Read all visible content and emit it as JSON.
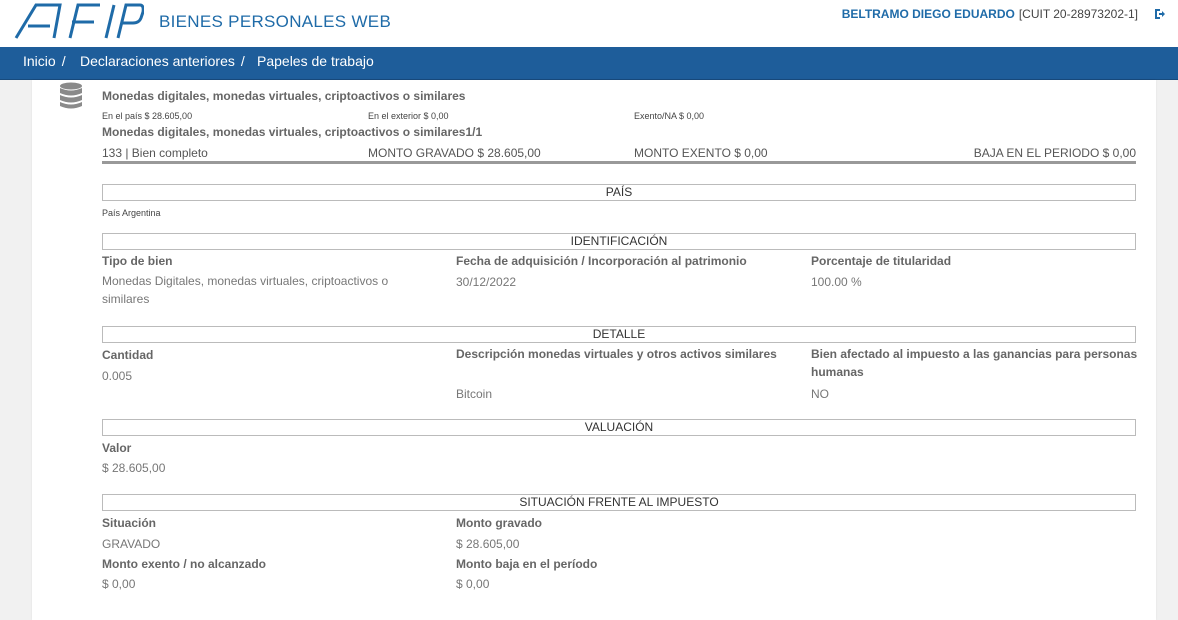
{
  "header": {
    "logo_text": "AFIP",
    "app_title": "BIENES PERSONALES WEB",
    "user_name": "BELTRAMO DIEGO EDUARDO",
    "cuit": "[CUIT 20-28973202-1]"
  },
  "breadcrumb": [
    {
      "label": "Inicio",
      "sep": "/"
    },
    {
      "label": "Declaraciones anteriores",
      "sep": "/"
    },
    {
      "label": "Papeles de trabajo",
      "sep": ""
    }
  ],
  "asset": {
    "title": "Monedas digitales, monedas virtuales, criptoactivos o similares",
    "en_pais": "En el país $ 28.605,00",
    "en_exterior": "En el exterior $ 0,00",
    "exento": "Exento/NA $ 0,00",
    "subtitle": "Monedas digitales, monedas virtuales, criptoactivos o similares1/1",
    "code": "133 | Bien completo",
    "monto_gravado": "MONTO GRAVADO $ 28.605,00",
    "monto_exento": "MONTO EXENTO $ 0,00",
    "baja": "BAJA EN EL PERIODO $ 0,00"
  },
  "pais": {
    "heading": "PAÍS",
    "value": "País Argentina"
  },
  "identificacion": {
    "heading": "IDENTIFICACIÓN",
    "tipo_label": "Tipo de bien",
    "tipo_value": "Monedas Digitales, monedas virtuales, criptoactivos o similares",
    "fecha_label": "Fecha de adquisición / Incorporación al patrimonio",
    "fecha_value": "30/12/2022",
    "porc_label": "Porcentaje de titularidad",
    "porc_value": "100.00 %"
  },
  "detalle": {
    "heading": "DETALLE",
    "cantidad_label": "Cantidad",
    "cantidad_value": "0.005",
    "desc_label": "Descripción monedas virtuales y otros activos similares",
    "desc_value": "Bitcoin",
    "bien_label": "Bien afectado al impuesto a las ganancias para personas humanas",
    "bien_value": "NO"
  },
  "valuacion": {
    "heading": "VALUACIÓN",
    "valor_label": "Valor",
    "valor_value": "$ 28.605,00"
  },
  "situacion": {
    "heading": "SITUACIÓN FRENTE AL IMPUESTO",
    "sit_label": "Situación",
    "sit_value": "GRAVADO",
    "gravado_label": "Monto gravado",
    "gravado_value": "$ 28.605,00",
    "exento_label": "Monto exento / no alcanzado",
    "exento_value": "$ 0,00",
    "baja_label": "Monto baja en el período",
    "baja_value": "$ 0,00"
  },
  "colors": {
    "brand_blue": "#1f6ba8",
    "nav_bg": "#1e5d9a"
  }
}
